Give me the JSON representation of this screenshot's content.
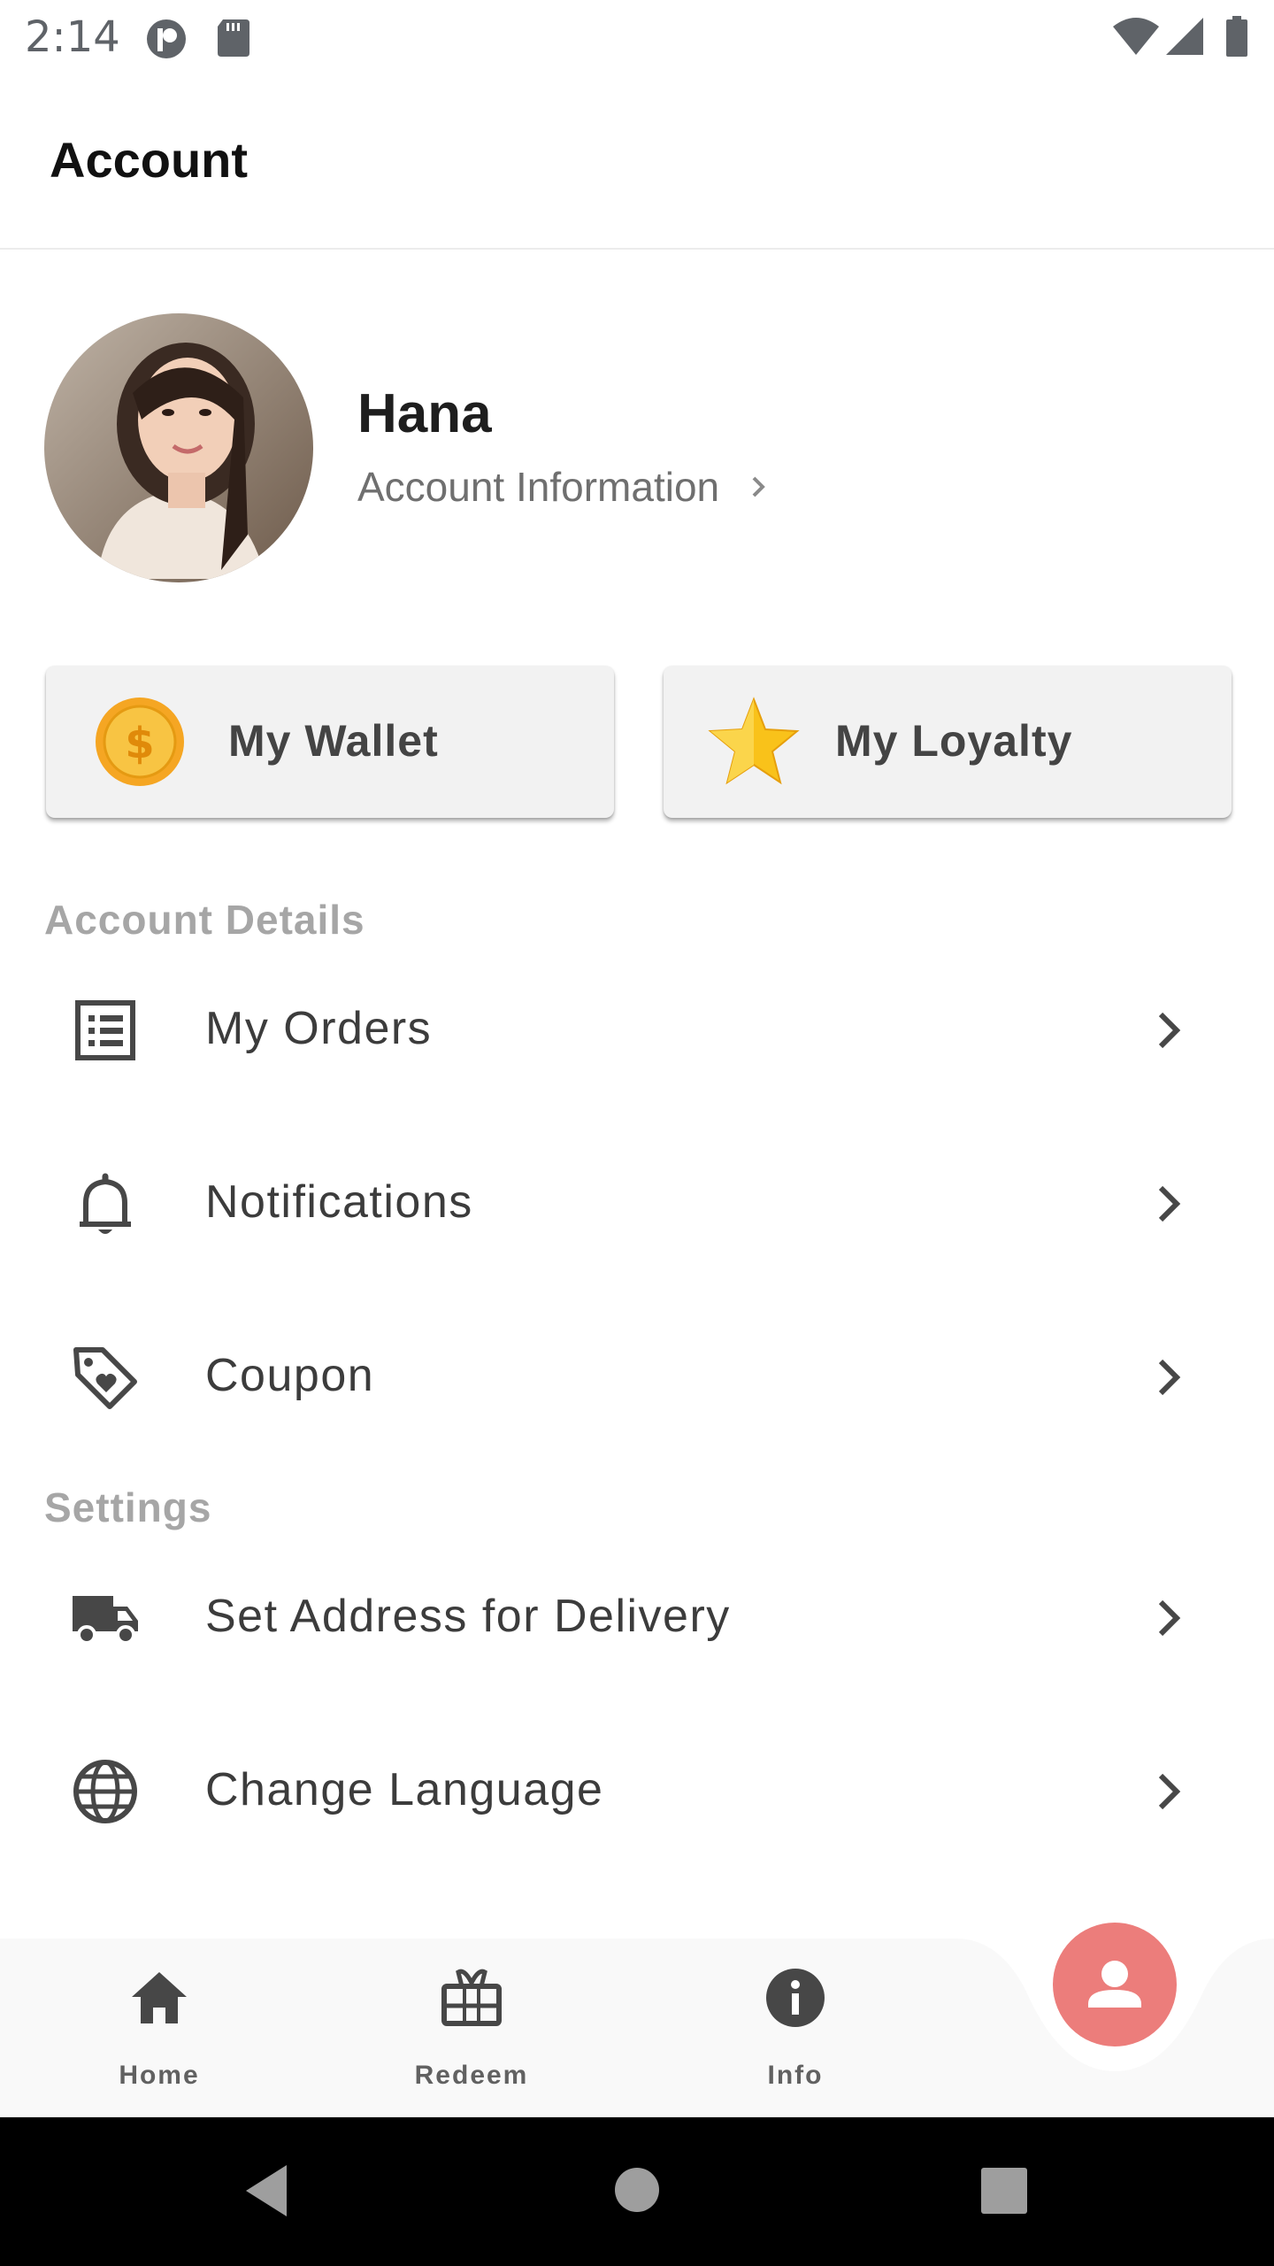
{
  "status_bar": {
    "time": "2:14",
    "left_icons": [
      "app-circle-icon",
      "sd-card-icon"
    ],
    "right_icons": [
      "wifi-icon",
      "cell-signal-icon",
      "battery-icon"
    ]
  },
  "app_bar": {
    "title": "Account"
  },
  "profile": {
    "name": "Hana",
    "info_link": "Account Information"
  },
  "cards": {
    "wallet": {
      "label": "My Wallet",
      "icon": "coin-icon",
      "color": "#f5b418"
    },
    "loyalty": {
      "label": "My Loyalty",
      "icon": "star-icon",
      "color": "#f7c31c"
    }
  },
  "sections": {
    "account_details": {
      "header": "Account Details",
      "items": [
        {
          "label": "My Orders",
          "icon": "orders-list-icon"
        },
        {
          "label": "Notifications",
          "icon": "bell-icon"
        },
        {
          "label": "Coupon",
          "icon": "coupon-tag-icon"
        }
      ]
    },
    "settings": {
      "header": "Settings",
      "items": [
        {
          "label": "Set Address for Delivery",
          "icon": "truck-icon"
        },
        {
          "label": "Change Language",
          "icon": "globe-icon"
        }
      ]
    }
  },
  "bottom_nav": {
    "items": [
      {
        "label": "Home",
        "icon": "home-icon"
      },
      {
        "label": "Redeem",
        "icon": "gift-icon"
      },
      {
        "label": "Info",
        "icon": "info-icon"
      }
    ],
    "active": {
      "icon": "person-icon",
      "color": "#ec7d7b"
    }
  },
  "system_nav": {
    "buttons": [
      "back-icon",
      "home-circle-icon",
      "recents-icon"
    ]
  },
  "colors": {
    "nav_background": "#f9f9f9",
    "section_header": "#a6a6a6",
    "icon": "#474747"
  }
}
